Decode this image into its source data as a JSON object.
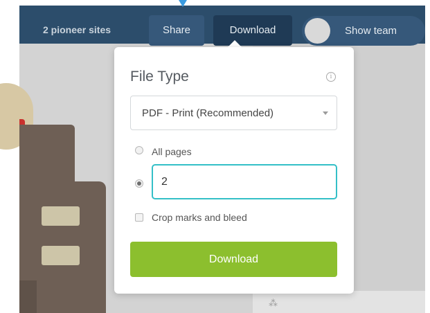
{
  "toolbar": {
    "team_name": "2 pioneer sites",
    "share_label": "Share",
    "download_label": "Download",
    "toggle_label": "Show team"
  },
  "popup": {
    "title": "File Type",
    "info_icon": "info-icon",
    "file_type": {
      "selected": "PDF - Print (Recommended)"
    },
    "pages": {
      "all_label": "All pages",
      "selected_option": "range",
      "range_value": "2"
    },
    "crop_marks": {
      "label": "Crop marks and bleed",
      "checked": false
    },
    "download_label": "Download"
  },
  "colors": {
    "toolbar": "#2c4d6b",
    "accent_input_border": "#33bfc7",
    "download_button": "#8cbf2e",
    "pointer": "#3a9be0"
  }
}
